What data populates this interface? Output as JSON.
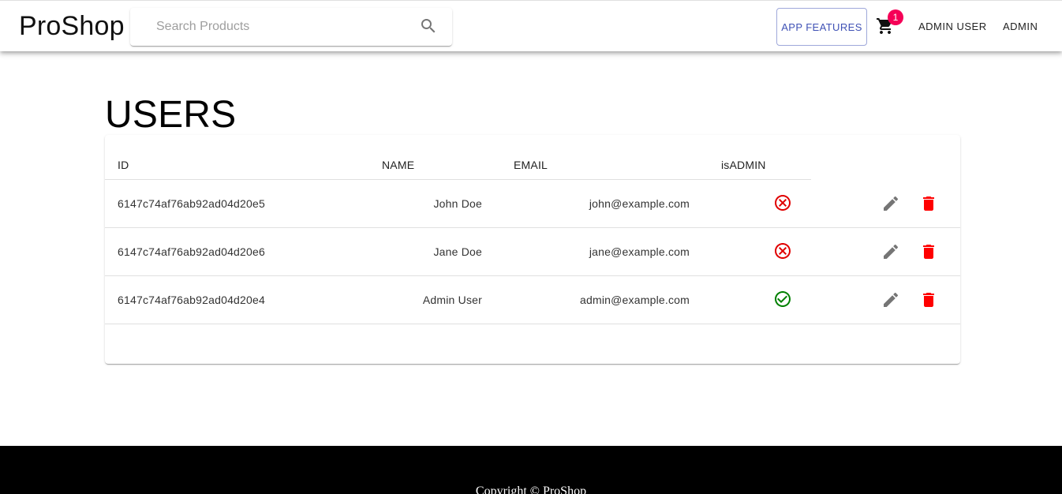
{
  "header": {
    "brand": "ProShop",
    "search": {
      "placeholder": "Search Products",
      "value": "",
      "icon": "search-icon"
    },
    "app_features_label": "APP FEATURES",
    "cart": {
      "icon": "shopping-cart-icon",
      "badge_count": "1"
    },
    "user_menu_label": "ADMIN USER",
    "admin_menu_label": "ADMIN"
  },
  "page": {
    "title": "USERS"
  },
  "users_table": {
    "columns": [
      "ID",
      "NAME",
      "EMAIL",
      "isADMIN"
    ],
    "rows": [
      {
        "id": "6147c74af76ab92ad04d20e5",
        "name": "John Doe",
        "email": "john@example.com",
        "is_admin": false
      },
      {
        "id": "6147c74af76ab92ad04d20e6",
        "name": "Jane Doe",
        "email": "jane@example.com",
        "is_admin": false
      },
      {
        "id": "6147c74af76ab92ad04d20e4",
        "name": "Admin User",
        "email": "admin@example.com",
        "is_admin": true
      }
    ]
  },
  "footer": {
    "copyright": "Copyright © ProShop"
  },
  "colors": {
    "primary": "#3f51b5",
    "badge": "#f50057",
    "admin_false": "#e00000",
    "admin_true": "#008000",
    "delete": "#ff0000",
    "edit": "#757575",
    "footer_bg": "#000000"
  }
}
